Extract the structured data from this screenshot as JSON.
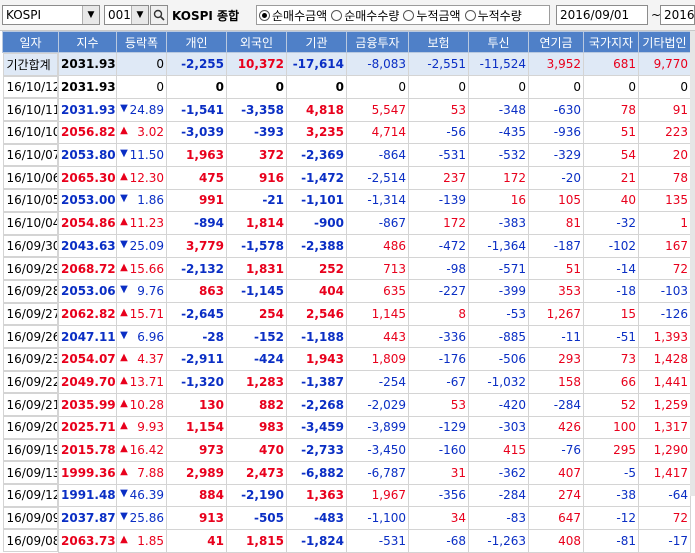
{
  "toolbar": {
    "market": "KOSPI",
    "code": "001",
    "index_name": "KOSPI 종합",
    "radios": [
      {
        "label": "순매수금액",
        "checked": true
      },
      {
        "label": "순매수수량",
        "checked": false
      },
      {
        "label": "누적금액",
        "checked": false
      },
      {
        "label": "누적수량",
        "checked": false
      }
    ],
    "date_from": "2016/09/01",
    "tilde": "~",
    "date_to": "2016/"
  },
  "columns": [
    "일자",
    "지수",
    "등락폭",
    "개인",
    "외국인",
    "기관",
    "금융투자",
    "보험",
    "투신",
    "연기금",
    "국가지자",
    "기타법인"
  ],
  "rows": [
    {
      "date": "기간합계",
      "index": "2031.93",
      "dir": "",
      "chg": "0",
      "vals": [
        "-2,255",
        "10,372",
        "-17,614",
        "-8,083",
        "-2,551",
        "-11,524",
        "3,952",
        "681",
        "9,770"
      ],
      "sum": true
    },
    {
      "date": "16/10/12",
      "index": "2031.93",
      "dir": "",
      "chg": "0",
      "vals": [
        "0",
        "0",
        "0",
        "0",
        "0",
        "0",
        "0",
        "0",
        "0"
      ]
    },
    {
      "date": "16/10/11",
      "index": "2031.93",
      "dir": "down",
      "chg": "24.89",
      "vals": [
        "-1,541",
        "-3,358",
        "4,818",
        "5,547",
        "53",
        "-348",
        "-630",
        "78",
        "91"
      ]
    },
    {
      "date": "16/10/10",
      "index": "2056.82",
      "dir": "up",
      "chg": "3.02",
      "vals": [
        "-3,039",
        "-393",
        "3,235",
        "4,714",
        "-56",
        "-435",
        "-936",
        "51",
        "223"
      ]
    },
    {
      "date": "16/10/07",
      "index": "2053.80",
      "dir": "down",
      "chg": "11.50",
      "vals": [
        "1,963",
        "372",
        "-2,369",
        "-864",
        "-531",
        "-532",
        "-329",
        "54",
        "20"
      ]
    },
    {
      "date": "16/10/06",
      "index": "2065.30",
      "dir": "up",
      "chg": "12.30",
      "vals": [
        "475",
        "916",
        "-1,472",
        "-2,514",
        "237",
        "172",
        "-20",
        "21",
        "78"
      ]
    },
    {
      "date": "16/10/05",
      "index": "2053.00",
      "dir": "down",
      "chg": "1.86",
      "vals": [
        "991",
        "-21",
        "-1,101",
        "-1,314",
        "-139",
        "16",
        "105",
        "40",
        "135"
      ]
    },
    {
      "date": "16/10/04",
      "index": "2054.86",
      "dir": "up",
      "chg": "11.23",
      "vals": [
        "-894",
        "1,814",
        "-900",
        "-867",
        "172",
        "-383",
        "81",
        "-32",
        "1"
      ]
    },
    {
      "date": "16/09/30",
      "index": "2043.63",
      "dir": "down",
      "chg": "25.09",
      "vals": [
        "3,779",
        "-1,578",
        "-2,388",
        "486",
        "-472",
        "-1,364",
        "-187",
        "-102",
        "167"
      ]
    },
    {
      "date": "16/09/29",
      "index": "2068.72",
      "dir": "up",
      "chg": "15.66",
      "vals": [
        "-2,132",
        "1,831",
        "252",
        "713",
        "-98",
        "-571",
        "51",
        "-14",
        "72"
      ]
    },
    {
      "date": "16/09/28",
      "index": "2053.06",
      "dir": "down",
      "chg": "9.76",
      "vals": [
        "863",
        "-1,145",
        "404",
        "635",
        "-227",
        "-399",
        "353",
        "-18",
        "-103"
      ]
    },
    {
      "date": "16/09/27",
      "index": "2062.82",
      "dir": "up",
      "chg": "15.71",
      "vals": [
        "-2,645",
        "254",
        "2,546",
        "1,145",
        "8",
        "-53",
        "1,267",
        "15",
        "-126"
      ]
    },
    {
      "date": "16/09/26",
      "index": "2047.11",
      "dir": "down",
      "chg": "6.96",
      "vals": [
        "-28",
        "-152",
        "-1,188",
        "443",
        "-336",
        "-885",
        "-11",
        "-51",
        "1,393"
      ]
    },
    {
      "date": "16/09/23",
      "index": "2054.07",
      "dir": "up",
      "chg": "4.37",
      "vals": [
        "-2,911",
        "-424",
        "1,943",
        "1,809",
        "-176",
        "-506",
        "293",
        "73",
        "1,428"
      ]
    },
    {
      "date": "16/09/22",
      "index": "2049.70",
      "dir": "up",
      "chg": "13.71",
      "vals": [
        "-1,320",
        "1,283",
        "-1,387",
        "-254",
        "-67",
        "-1,032",
        "158",
        "66",
        "1,441"
      ]
    },
    {
      "date": "16/09/21",
      "index": "2035.99",
      "dir": "up",
      "chg": "10.28",
      "vals": [
        "130",
        "882",
        "-2,268",
        "-2,029",
        "53",
        "-420",
        "-284",
        "52",
        "1,259"
      ]
    },
    {
      "date": "16/09/20",
      "index": "2025.71",
      "dir": "up",
      "chg": "9.93",
      "vals": [
        "1,154",
        "983",
        "-3,459",
        "-3,899",
        "-129",
        "-303",
        "426",
        "100",
        "1,317"
      ]
    },
    {
      "date": "16/09/19",
      "index": "2015.78",
      "dir": "up",
      "chg": "16.42",
      "vals": [
        "973",
        "470",
        "-2,733",
        "-3,450",
        "-160",
        "415",
        "-76",
        "295",
        "1,290"
      ]
    },
    {
      "date": "16/09/13",
      "index": "1999.36",
      "dir": "up",
      "chg": "7.88",
      "vals": [
        "2,989",
        "2,473",
        "-6,882",
        "-6,787",
        "31",
        "-362",
        "407",
        "-5",
        "1,417"
      ]
    },
    {
      "date": "16/09/12",
      "index": "1991.48",
      "dir": "down",
      "chg": "46.39",
      "vals": [
        "884",
        "-2,190",
        "1,363",
        "1,967",
        "-356",
        "-284",
        "274",
        "-38",
        "-64"
      ]
    },
    {
      "date": "16/09/09",
      "index": "2037.87",
      "dir": "down",
      "chg": "25.86",
      "vals": [
        "913",
        "-505",
        "-483",
        "-1,100",
        "34",
        "-83",
        "647",
        "-12",
        "72"
      ]
    },
    {
      "date": "16/09/08",
      "index": "2063.73",
      "dir": "up",
      "chg": "1.85",
      "vals": [
        "41",
        "1,815",
        "-1,824",
        "-531",
        "-68",
        "-1,263",
        "408",
        "-81",
        "-17"
      ]
    }
  ],
  "colors": {
    "up": "#e8001c",
    "down": "#0a2ec4",
    "header_bg": "#4f80c8",
    "sum_row_bg": "#dfe9f6"
  },
  "icons": {
    "up": "triangle-up-icon",
    "down": "triangle-down-icon",
    "dropdown": "chevron-down-icon",
    "search": "search-icon"
  }
}
